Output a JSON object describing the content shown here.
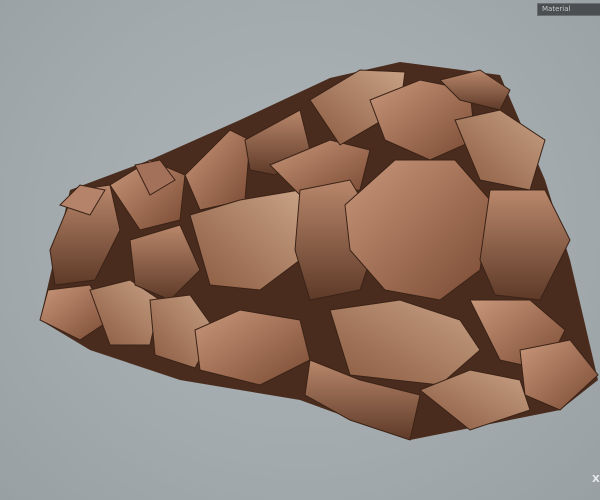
{
  "viewer": {
    "material_dropdown": "Material",
    "axis_label": "X"
  },
  "colors": {
    "background": "#a4acaf",
    "rock_light": "#b98a6c",
    "rock_mid": "#8f5a3e",
    "rock_dark": "#4a2c1e"
  }
}
